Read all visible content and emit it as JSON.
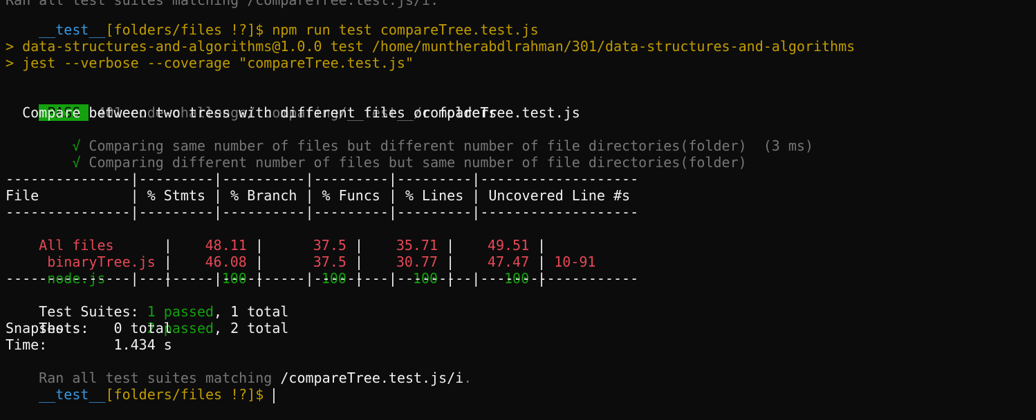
{
  "terminal": {
    "prompt_top": {
      "cut_text": "Ran all test suites matching /compareTree.test.js/i.",
      "user": "__test__",
      "rest": "[folders/files !?]$ npm run test compareTree.test.js"
    },
    "npm_lines": [
      "> data-structures-and-algorithms@1.0.0 test /home/muntherabdlrahman/301/data-structures-and-algorithms",
      "> jest --verbose --coverage \"compareTree.test.js\""
    ],
    "pass": {
      "badge": " PASS ",
      "path": " 401-code-challenge/ comparing/__test__/",
      "file": "compareTree.test.js"
    },
    "describe": "  Compare between two tress with different files or folders",
    "tests": [
      {
        "check": "    √ ",
        "name": "Comparing same number of files but different number of file directories(folder)  (3 ms)"
      },
      {
        "check": "    √ ",
        "name": "Comparing different number of files but same number of file directories(folder)"
      }
    ],
    "coverage": {
      "separator": "---------------|---------|----------|---------|---------|-------------------",
      "header": "File           | % Stmts | % Branch | % Funcs | % Lines | Uncovered Line #s ",
      "rows": [
        {
          "file": "All files      ",
          "stmts": "48.11",
          "branch": "37.5",
          "funcs": "35.71",
          "lines": "49.51",
          "uncovered": "",
          "color": "#e74856"
        },
        {
          "file": " binaryTree.js ",
          "stmts": "46.08",
          "branch": "37.5",
          "funcs": "30.77",
          "lines": "47.47",
          "uncovered": "10-91",
          "color": "#e74856"
        },
        {
          "file": " node.js       ",
          "stmts": "100",
          "branch": "100",
          "funcs": "100",
          "lines": "100",
          "uncovered": "",
          "color": "#13a10e"
        }
      ]
    },
    "summary": {
      "suites_label": "Test Suites: ",
      "suites_passed": "1 passed",
      "suites_rest": ", 1 total",
      "tests_label": "Tests:       ",
      "tests_passed": "2 passed",
      "tests_rest": ", 2 total",
      "snapshots": "Snapshots:   0 total",
      "time": "Time:        1.434 s",
      "ran_prefix": "Ran all test suites matching ",
      "ran_pattern": "/compareTree.test.js/i",
      "ran_suffix": "."
    },
    "prompt_bottom": {
      "user": "__test__",
      "rest": "[folders/files !?]$ "
    }
  }
}
